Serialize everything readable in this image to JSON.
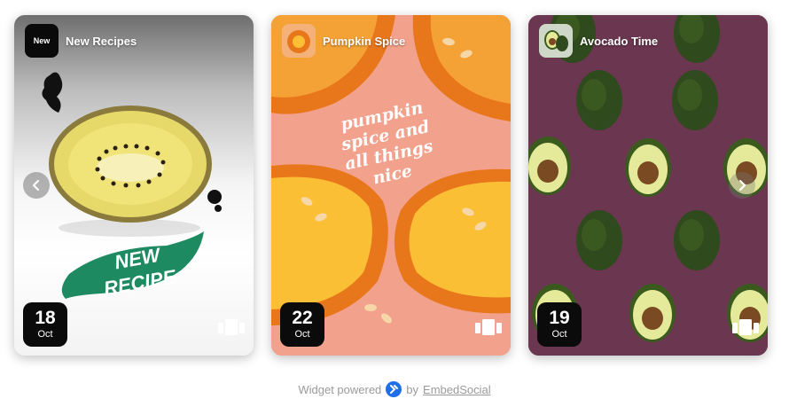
{
  "cards": [
    {
      "title": "New Recipes",
      "avatar_text": "New",
      "day": "18",
      "month": "Oct",
      "art_text": [
        "NEW",
        "RECIPE"
      ]
    },
    {
      "title": "Pumpkin Spice",
      "day": "22",
      "month": "Oct",
      "art_text": [
        "pumpkin",
        "spice and",
        "all things",
        "nice"
      ]
    },
    {
      "title": "Avocado Time",
      "day": "19",
      "month": "Oct"
    }
  ],
  "footer": {
    "prefix": "Widget powered",
    "by": "by",
    "brand": "EmbedSocial"
  },
  "colors": {
    "accent": "#1f6feb",
    "date_bg": "#0b0b0b",
    "brush_green": "#1e8a61"
  },
  "icons": {
    "prev": "chevron-left-icon",
    "next": "chevron-right-icon",
    "stories": "stories-icon"
  }
}
